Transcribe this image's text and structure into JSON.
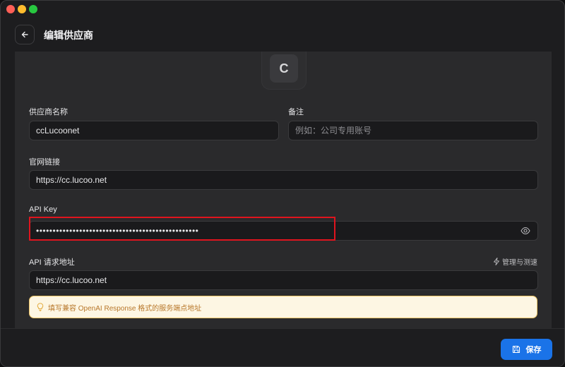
{
  "header": {
    "title": "编辑供应商"
  },
  "provider": {
    "avatar_letter": "C"
  },
  "form": {
    "name": {
      "label": "供应商名称",
      "value": "ccLucoonet"
    },
    "note": {
      "label": "备注",
      "placeholder": "例如：公司专用账号"
    },
    "website": {
      "label": "官网链接",
      "value": "https://cc.lucoo.net"
    },
    "api_key": {
      "label": "API Key",
      "value": "•••••••••••••••••••••••••••••••••••••••••••••••••"
    },
    "api_url": {
      "label": "API 请求地址",
      "value": "https://cc.lucoo.net",
      "manage_label": "管理与测速"
    },
    "hint": "填写兼容 OpenAI Response 格式的服务端点地址"
  },
  "footer": {
    "save_label": "保存"
  },
  "colors": {
    "accent": "#1a73e8",
    "highlight": "#e0141e",
    "hint_bg": "#fdf6e3",
    "hint_text": "#b8772a"
  }
}
